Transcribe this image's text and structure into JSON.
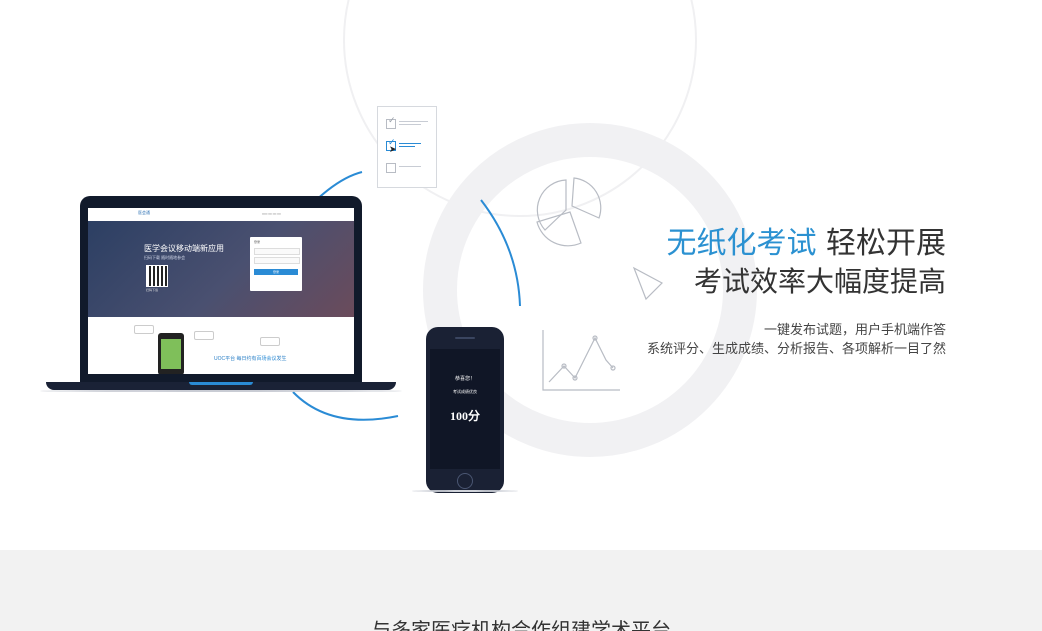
{
  "hero": {
    "headline_accent": "无纸化考试",
    "headline_rest": " 轻松开展",
    "headline_line2": "考试效率大幅度提高",
    "sub_line1": "一键发布试题，用户手机端作答",
    "sub_line2": "系统评分、生成成绩、分析报告、各项解析一目了然",
    "accent_color": "#2b91d1"
  },
  "laptop_screen": {
    "logo": "医会通",
    "banner_title": "医学会议移动端新应用",
    "banner_sub": "扫码下载  随时随地参会",
    "qr_label": "扫码下载",
    "login_title": "登录",
    "login_button": "登录",
    "caption_prefix": "UOC平台  每日约有",
    "caption_accent": "百场会议",
    "caption_suffix": "发生"
  },
  "phone_screen": {
    "greeting": "恭喜您！",
    "message": "考试成绩优良",
    "score": "100分"
  },
  "partners": {
    "title": "与多家医疗机构合作组建学术平台"
  },
  "icons": [
    "checklist-card-icon",
    "pie-chart-icon",
    "line-chart-icon",
    "play-arrow-icon",
    "cursor-icon"
  ]
}
